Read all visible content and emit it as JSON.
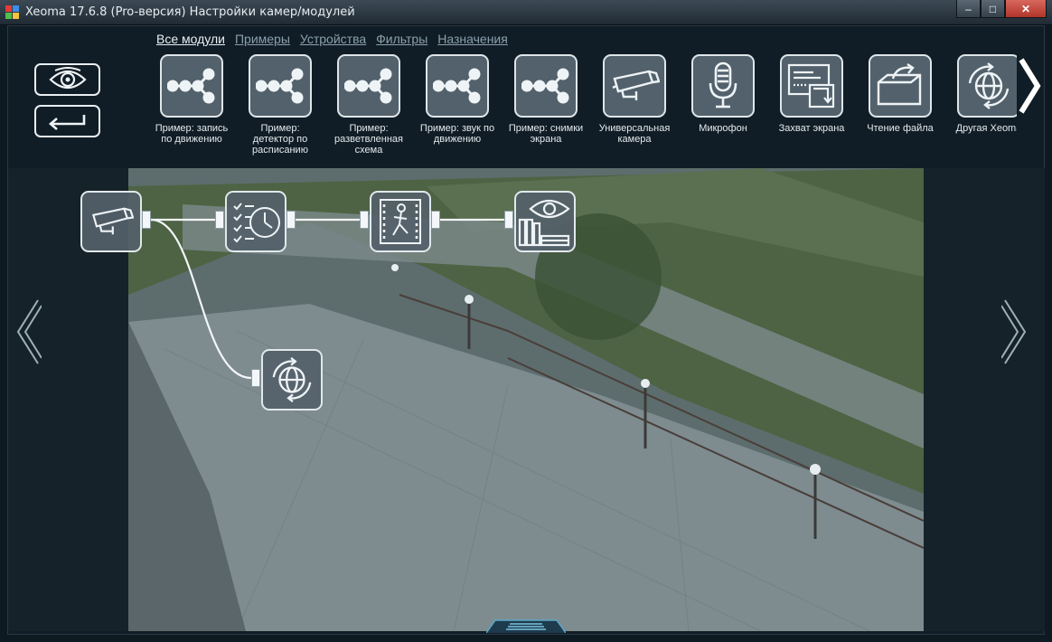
{
  "window": {
    "title": "Xeoma 17.6.8 (Pro-версия) Настройки камер/модулей",
    "minimize_glyph": "–",
    "maximize_glyph": "□",
    "close_glyph": "✕"
  },
  "nav": {
    "tabs": [
      {
        "label": "Все модули",
        "active": true
      },
      {
        "label": "Примеры",
        "active": false
      },
      {
        "label": "Устройства",
        "active": false
      },
      {
        "label": "Фильтры",
        "active": false
      },
      {
        "label": "Назначения",
        "active": false
      }
    ]
  },
  "modules": [
    {
      "label": "Пример: запись\nпо движению",
      "icon": "chain-icon"
    },
    {
      "label": "Пример:\nдетектор по\nрасписанию",
      "icon": "chain-icon"
    },
    {
      "label": "Пример:\nразветвленная\nсхема",
      "icon": "chain-icon"
    },
    {
      "label": "Пример: звук по\nдвижению",
      "icon": "chain-icon"
    },
    {
      "label": "Пример: снимки\nэкрана",
      "icon": "chain-icon"
    },
    {
      "label": "Универсальная\nкамера",
      "icon": "camera-icon"
    },
    {
      "label": "Микрофон",
      "icon": "microphone-icon"
    },
    {
      "label": "Захват экрана",
      "icon": "screen-capture-icon"
    },
    {
      "label": "Чтение файла",
      "icon": "file-read-icon"
    },
    {
      "label": "Другая Xeoma",
      "icon": "globe-icon"
    }
  ],
  "chain": {
    "nodes": [
      {
        "name": "camera-node",
        "icon": "camera-icon"
      },
      {
        "name": "scheduler-node",
        "icon": "scheduler-icon"
      },
      {
        "name": "motion-detector-node",
        "icon": "motion-detector-icon"
      },
      {
        "name": "preview-archive-node",
        "icon": "preview-archive-icon"
      },
      {
        "name": "other-xeoma-node",
        "icon": "globe-icon"
      }
    ]
  },
  "colors": {
    "accent": "#e8eef2",
    "panel": "#111d26",
    "tile": "#52616b",
    "nav_inactive": "#8ba0ad"
  }
}
